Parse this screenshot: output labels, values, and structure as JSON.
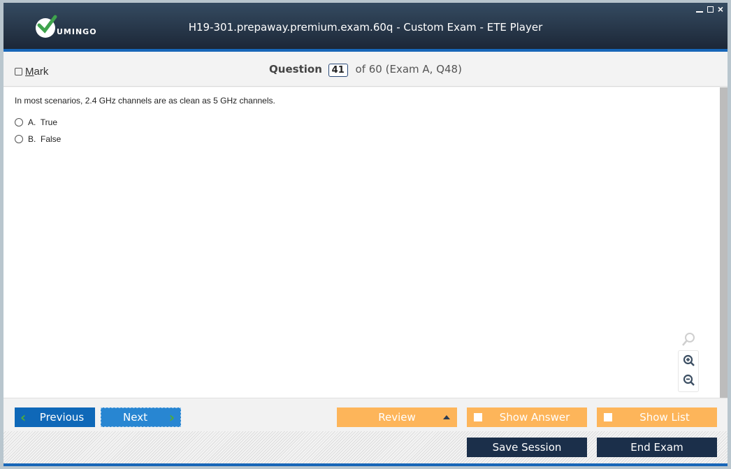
{
  "window": {
    "title": "H19-301.prepaway.premium.exam.60q - Custom Exam - ETE Player",
    "logo_text": "UMINGO",
    "controls": {
      "minimize": "minimize-icon",
      "maximize": "maximize-icon",
      "close": "×"
    }
  },
  "question_bar": {
    "mark_label_prefix": "M",
    "mark_label_rest": "ark",
    "question_label": "Question",
    "current_number": "41",
    "of_text": "of 60 (Exam A, Q48)"
  },
  "question": {
    "text": "In most scenarios, 2.4 GHz channels are as clean as 5 GHz channels.",
    "options": [
      {
        "label": "A.  True"
      },
      {
        "label": "B.  False"
      }
    ]
  },
  "zoom_tools": {
    "search": "search-icon",
    "zoom_in": "zoom-in-icon",
    "zoom_out": "zoom-out-icon"
  },
  "nav": {
    "previous": "Previous",
    "next": "Next",
    "review": "Review",
    "show_answer": "Show Answer",
    "show_list": "Show List"
  },
  "footer": {
    "save_session": "Save Session",
    "end_exam": "End Exam"
  },
  "colors": {
    "accent_blue": "#1766b8",
    "orange": "#fdb55a",
    "dark_navy": "#1b2f4a",
    "check_green": "#4dab3c"
  }
}
